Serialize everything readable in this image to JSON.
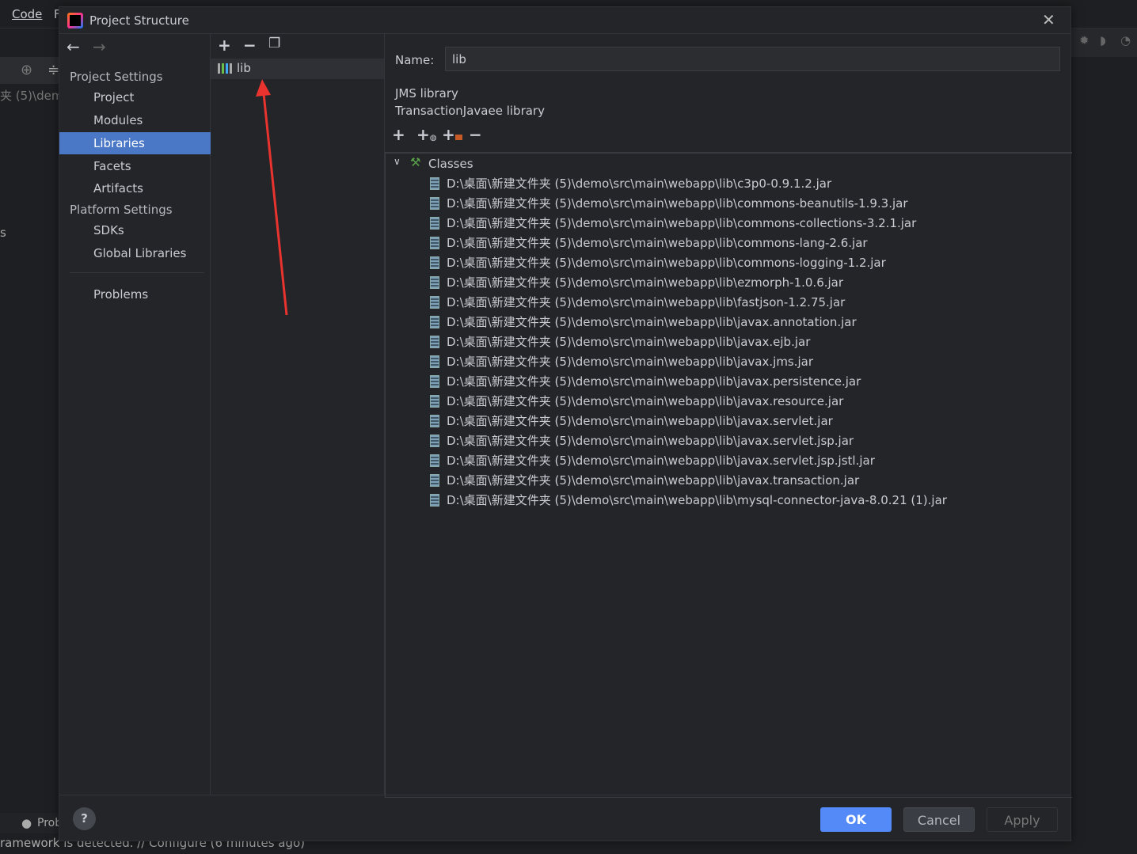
{
  "ide": {
    "menu_code": "Code",
    "menu_partial": "F",
    "path_fragment": "夹 (5)\\dem",
    "side_fragment": "s",
    "problems_tab": "Prob",
    "status_text": "ramework is detected. // Configure (6 minutes ago)"
  },
  "dialog": {
    "title": "Project Structure",
    "nav": {
      "project_settings": "Project Settings",
      "items": [
        {
          "label": "Project"
        },
        {
          "label": "Modules"
        },
        {
          "label": "Libraries",
          "selected": true
        },
        {
          "label": "Facets"
        },
        {
          "label": "Artifacts"
        }
      ],
      "platform_settings": "Platform Settings",
      "platform_items": [
        {
          "label": "SDKs"
        },
        {
          "label": "Global Libraries"
        }
      ],
      "problems": "Problems"
    },
    "libraries": [
      {
        "name": "lib",
        "selected": true
      }
    ],
    "detail": {
      "name_label": "Name:",
      "name_value": "lib",
      "library_types": [
        "JMS library",
        "TransactionJavaee library"
      ],
      "classes_label": "Classes",
      "jars": [
        "D:\\桌面\\新建文件夹 (5)\\demo\\src\\main\\webapp\\lib\\c3p0-0.9.1.2.jar",
        "D:\\桌面\\新建文件夹 (5)\\demo\\src\\main\\webapp\\lib\\commons-beanutils-1.9.3.jar",
        "D:\\桌面\\新建文件夹 (5)\\demo\\src\\main\\webapp\\lib\\commons-collections-3.2.1.jar",
        "D:\\桌面\\新建文件夹 (5)\\demo\\src\\main\\webapp\\lib\\commons-lang-2.6.jar",
        "D:\\桌面\\新建文件夹 (5)\\demo\\src\\main\\webapp\\lib\\commons-logging-1.2.jar",
        "D:\\桌面\\新建文件夹 (5)\\demo\\src\\main\\webapp\\lib\\ezmorph-1.0.6.jar",
        "D:\\桌面\\新建文件夹 (5)\\demo\\src\\main\\webapp\\lib\\fastjson-1.2.75.jar",
        "D:\\桌面\\新建文件夹 (5)\\demo\\src\\main\\webapp\\lib\\javax.annotation.jar",
        "D:\\桌面\\新建文件夹 (5)\\demo\\src\\main\\webapp\\lib\\javax.ejb.jar",
        "D:\\桌面\\新建文件夹 (5)\\demo\\src\\main\\webapp\\lib\\javax.jms.jar",
        "D:\\桌面\\新建文件夹 (5)\\demo\\src\\main\\webapp\\lib\\javax.persistence.jar",
        "D:\\桌面\\新建文件夹 (5)\\demo\\src\\main\\webapp\\lib\\javax.resource.jar",
        "D:\\桌面\\新建文件夹 (5)\\demo\\src\\main\\webapp\\lib\\javax.servlet.jar",
        "D:\\桌面\\新建文件夹 (5)\\demo\\src\\main\\webapp\\lib\\javax.servlet.jsp.jar",
        "D:\\桌面\\新建文件夹 (5)\\demo\\src\\main\\webapp\\lib\\javax.servlet.jsp.jstl.jar",
        "D:\\桌面\\新建文件夹 (5)\\demo\\src\\main\\webapp\\lib\\javax.transaction.jar",
        "D:\\桌面\\新建文件夹 (5)\\demo\\src\\main\\webapp\\lib\\mysql-connector-java-8.0.21 (1).jar"
      ]
    },
    "buttons": {
      "ok": "OK",
      "cancel": "Cancel",
      "apply": "Apply",
      "help": "?"
    }
  },
  "colors": {
    "accent": "#4a78c7",
    "ok_button": "#548af7",
    "annotation_arrow": "#e8332e"
  }
}
